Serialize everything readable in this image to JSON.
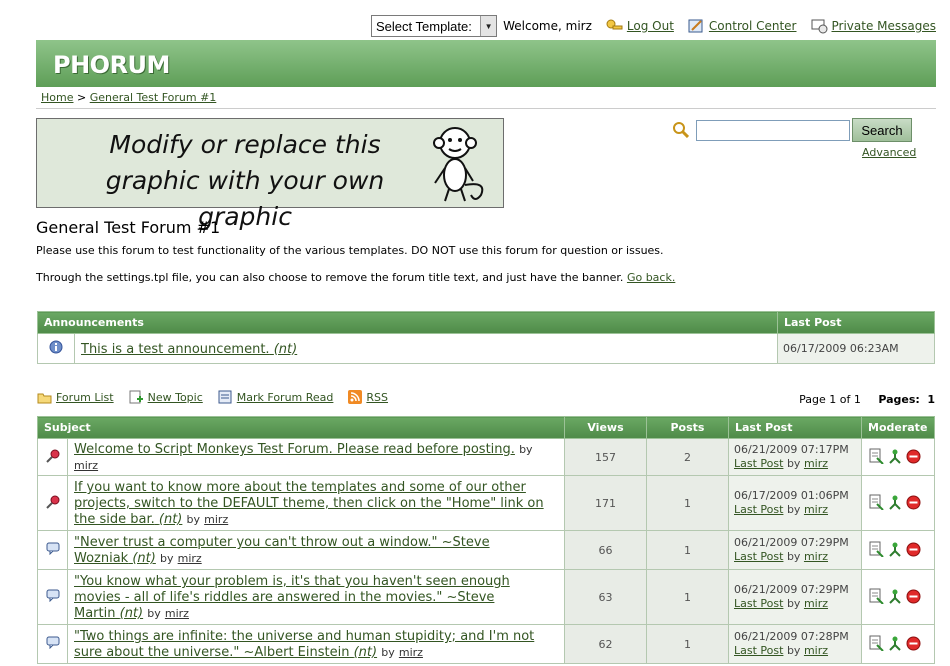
{
  "userbar": {
    "template_select": "Select Template:",
    "welcome": "Welcome, mirz",
    "logout": "Log Out",
    "control_center": "Control Center",
    "private_messages": "Private Messages"
  },
  "header": {
    "logo": "PHORUM"
  },
  "breadcrumb": {
    "home": "Home",
    "separator": ">",
    "forum": "General Test Forum #1"
  },
  "banner": {
    "line1": "Modify or replace this",
    "line2": "graphic with your own graphic"
  },
  "search": {
    "button": "Search",
    "advanced": "Advanced",
    "value": ""
  },
  "forum": {
    "title": "General Test Forum #1",
    "desc1": "Please use this forum to test functionality of the various templates. DO NOT use this forum for question or issues.",
    "desc2": "Through the settings.tpl file, you can also choose to remove the forum title text, and just have the banner.",
    "go_back": "Go back."
  },
  "announcements": {
    "headers": {
      "title": "Announcements",
      "last_post": "Last Post"
    },
    "rows": [
      {
        "subject": "This is a test announcement.",
        "tag": "(nt)",
        "last_post": "06/17/2009 06:23AM"
      }
    ]
  },
  "toolbar": {
    "forum_list": "Forum List",
    "new_topic": "New Topic",
    "mark_read": "Mark Forum Read",
    "rss": "RSS"
  },
  "pager": {
    "page_of": "Page 1 of 1",
    "pages_label": "Pages:",
    "current": "1"
  },
  "messages": {
    "headers": {
      "subject": "Subject",
      "views": "Views",
      "posts": "Posts",
      "last_post": "Last Post",
      "moderate": "Moderate"
    },
    "by": "by",
    "last_post_link": "Last Post",
    "rows": [
      {
        "type": "sticky",
        "lines": [
          "Welcome to Script Monkeys Test Forum. Please read before posting."
        ],
        "tag": "",
        "author": "mirz",
        "views": "157",
        "posts": "2",
        "date": "06/21/2009 07:17PM",
        "last_author": "mirz"
      },
      {
        "type": "sticky",
        "lines": [
          "If you want to know more about the templates and some of our other",
          "projects, switch to the DEFAULT theme, then click on the \"Home\" link on",
          "the side bar."
        ],
        "tag": "(nt)",
        "author": "mirz",
        "views": "171",
        "posts": "1",
        "date": "06/17/2009 01:06PM",
        "last_author": "mirz"
      },
      {
        "type": "normal",
        "lines": [
          "\"Never trust a computer you can't throw out a window.\" ~Steve",
          "Wozniak"
        ],
        "tag": "(nt)",
        "author": "mirz",
        "views": "66",
        "posts": "1",
        "date": "06/21/2009 07:29PM",
        "last_author": "mirz"
      },
      {
        "type": "normal",
        "lines": [
          "\"You know what your problem is, it's that you haven't seen enough",
          "movies - all of life's riddles are answered in the movies.\" ~Steve",
          "Martin"
        ],
        "tag": "(nt)",
        "author": "mirz",
        "views": "63",
        "posts": "1",
        "date": "06/21/2009 07:29PM",
        "last_author": "mirz"
      },
      {
        "type": "normal",
        "lines": [
          "\"Two things are infinite: the universe and human stupidity; and I'm not",
          "sure about the universe.\" ~Albert Einstein"
        ],
        "tag": "(nt)",
        "author": "mirz",
        "views": "62",
        "posts": "1",
        "date": "06/21/2009 07:28PM",
        "last_author": "mirz"
      }
    ]
  }
}
